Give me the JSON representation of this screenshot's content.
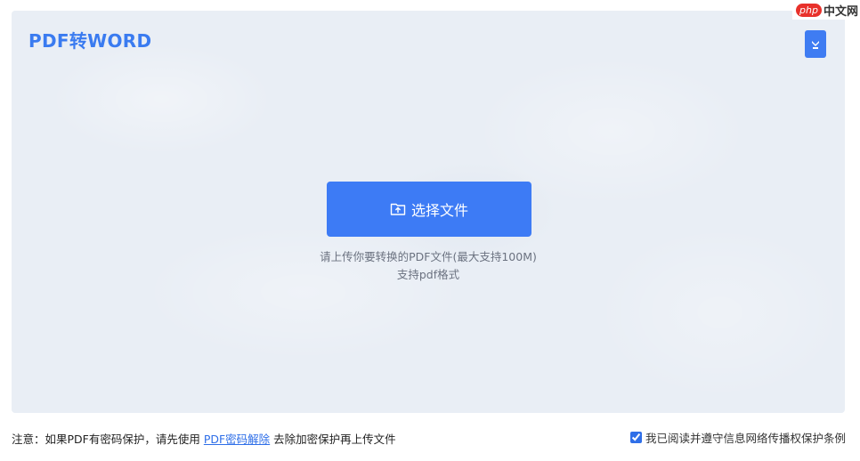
{
  "header": {
    "title": "PDF转WORD",
    "corner_icon": "download-bird-icon"
  },
  "upload": {
    "button_label": "选择文件",
    "button_icon": "folder-upload-icon",
    "hint_size": "请上传你要转换的PDF文件(最大支持100M)",
    "hint_format": "支持pdf格式"
  },
  "footer": {
    "note_prefix": "注意：如果PDF有密码保护，请先使用 ",
    "note_link": "PDF密码解除",
    "note_suffix": " 去除加密保护再上传文件",
    "agree_label": "我已阅读并遵守信息网络传播权保护条例",
    "agree_checked": true
  },
  "watermark": {
    "badge": "php",
    "text": "中文网"
  },
  "colors": {
    "accent": "#3d7bf5",
    "link": "#2f6fe8",
    "panel_bg": "#e9eef5"
  }
}
